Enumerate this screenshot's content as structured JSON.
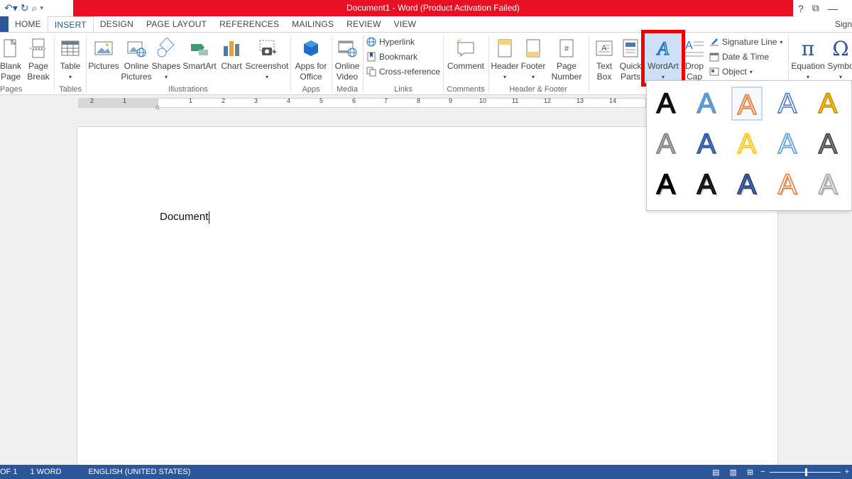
{
  "title": "Document1 -  Word (Product Activation Failed)",
  "window": {
    "help": "?",
    "restore": "⧉",
    "minimize": "—"
  },
  "tabs": [
    "HOME",
    "INSERT",
    "DESIGN",
    "PAGE LAYOUT",
    "REFERENCES",
    "MAILINGS",
    "REVIEW",
    "VIEW"
  ],
  "sign_in": "Sign",
  "ribbon": {
    "blank_page": "Blank\nPage",
    "page_break": "Page\nBreak",
    "table": "Table",
    "pictures": "Pictures",
    "online_pictures": "Online\nPictures",
    "shapes": "Shapes",
    "smartart": "SmartArt",
    "chart": "Chart",
    "screenshot": "Screenshot",
    "apps_for_office": "Apps for\nOffice",
    "online_video": "Online\nVideo",
    "hyperlink": "Hyperlink",
    "bookmark": "Bookmark",
    "cross_reference": "Cross-reference",
    "comment": "Comment",
    "header": "Header",
    "footer": "Footer",
    "page_number": "Page\nNumber",
    "text_box": "Text\nBox",
    "quick_parts": "Quick\nParts",
    "wordart": "WordArt",
    "drop_cap": "Drop\nCap",
    "signature_line": "Signature Line",
    "date_time": "Date & Time",
    "object": "Object",
    "equation": "Equation",
    "symbol": "Symbo",
    "groups": {
      "pages": "Pages",
      "tables": "Tables",
      "illustrations": "Illustrations",
      "apps": "Apps",
      "media": "Media",
      "links": "Links",
      "comments": "Comments",
      "header_footer": "Header & Footer"
    }
  },
  "ruler_numbers": [
    "2",
    "1",
    "1",
    "2",
    "3",
    "4",
    "5",
    "6",
    "7",
    "8",
    "9",
    "10",
    "11",
    "12",
    "13",
    "14"
  ],
  "document": {
    "text": "Document"
  },
  "wordart_glyph": "A",
  "wordart_styles": [
    {
      "color": "#111111",
      "stroke": "#111111",
      "fill": "#111111"
    },
    {
      "color": "#5b9bd5",
      "stroke": "#5b9bd5",
      "fill": "#5b9bd5"
    },
    {
      "color": "#f4b183",
      "stroke": "#e07a3c",
      "fill": "#f8cbad"
    },
    {
      "color": "#ffffff",
      "stroke": "#4472c4",
      "fill": "#ffffff"
    },
    {
      "color": "#ffc000",
      "stroke": "#bf9000",
      "fill": "#ffc000"
    },
    {
      "color": "#a6a6a6",
      "stroke": "#7f7f7f",
      "fill": "#a6a6a6"
    },
    {
      "color": "#4472c4",
      "stroke": "#2f5597",
      "fill": "#4472c4"
    },
    {
      "color": "#ffe699",
      "stroke": "#ffc000",
      "fill": "#ffe699"
    },
    {
      "color": "#ddebf7",
      "stroke": "#5b9bd5",
      "fill": "#ddebf7"
    },
    {
      "color": "#595959",
      "stroke": "#404040",
      "fill": "#7f7f7f"
    },
    {
      "color": "#000000",
      "stroke": "#000000",
      "fill": "#000000"
    },
    {
      "color": "#262626",
      "stroke": "#000000",
      "fill": "#262626"
    },
    {
      "color": "#4472c4",
      "stroke": "#203864",
      "fill": "#4472c4"
    },
    {
      "color": "#ffffff",
      "stroke": "#ed7d31",
      "fill": "#ffffff"
    },
    {
      "color": "#f2f2f2",
      "stroke": "#a6a6a6",
      "fill": "#e7e6e6"
    }
  ],
  "status": {
    "page": "OF 1",
    "words": "1 WORD",
    "language": "ENGLISH (UNITED STATES)"
  },
  "colors": {
    "title_red": "#e81123",
    "word_blue": "#2b579a",
    "highlight_red": "#e00000"
  }
}
